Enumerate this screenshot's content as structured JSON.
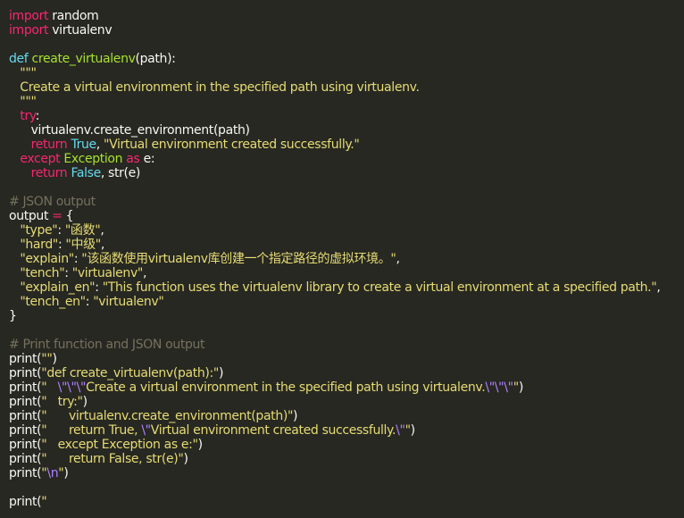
{
  "theme": {
    "background": "#272822",
    "foreground": "#f8f8f2",
    "keyword": "#f92672",
    "function_name": "#a6e22e",
    "builtin": "#66d9ef",
    "string": "#e6db74",
    "comment": "#75715e",
    "escape": "#ae81ff"
  },
  "code_lines": [
    [
      {
        "t": "kw",
        "v": "import"
      },
      {
        "t": "pl",
        "v": " random"
      }
    ],
    [
      {
        "t": "kw",
        "v": "import"
      },
      {
        "t": "pl",
        "v": " virtualenv"
      }
    ],
    [],
    [
      {
        "t": "bi",
        "v": "def"
      },
      {
        "t": "pl",
        "v": " "
      },
      {
        "t": "fn",
        "v": "create_virtualenv"
      },
      {
        "t": "pl",
        "v": "(path):"
      }
    ],
    [
      {
        "t": "str",
        "v": "   \"\"\""
      }
    ],
    [
      {
        "t": "str",
        "v": "   Create a virtual environment in the specified path using virtualenv."
      }
    ],
    [
      {
        "t": "str",
        "v": "   \"\"\""
      }
    ],
    [
      {
        "t": "pl",
        "v": "   "
      },
      {
        "t": "kw",
        "v": "try"
      },
      {
        "t": "pl",
        "v": ":"
      }
    ],
    [
      {
        "t": "pl",
        "v": "      virtualenv.create_environment(path)"
      }
    ],
    [
      {
        "t": "pl",
        "v": "      "
      },
      {
        "t": "kw",
        "v": "return"
      },
      {
        "t": "pl",
        "v": " "
      },
      {
        "t": "bi",
        "v": "True"
      },
      {
        "t": "pl",
        "v": ", "
      },
      {
        "t": "str",
        "v": "\"Virtual environment created successfully.\""
      }
    ],
    [
      {
        "t": "pl",
        "v": "   "
      },
      {
        "t": "kw",
        "v": "except"
      },
      {
        "t": "pl",
        "v": " "
      },
      {
        "t": "fn",
        "v": "Exception"
      },
      {
        "t": "pl",
        "v": " "
      },
      {
        "t": "kw",
        "v": "as"
      },
      {
        "t": "pl",
        "v": " e:"
      }
    ],
    [
      {
        "t": "pl",
        "v": "      "
      },
      {
        "t": "kw",
        "v": "return"
      },
      {
        "t": "pl",
        "v": " "
      },
      {
        "t": "bi",
        "v": "False"
      },
      {
        "t": "pl",
        "v": ", str(e)"
      }
    ],
    [],
    [
      {
        "t": "cm",
        "v": "# JSON output"
      }
    ],
    [
      {
        "t": "pl",
        "v": "output "
      },
      {
        "t": "kw",
        "v": "="
      },
      {
        "t": "pl",
        "v": " {"
      }
    ],
    [
      {
        "t": "pl",
        "v": "   "
      },
      {
        "t": "str",
        "v": "\"type\""
      },
      {
        "t": "pl",
        "v": ": "
      },
      {
        "t": "str",
        "v": "\"函数\""
      },
      {
        "t": "pl",
        "v": ","
      }
    ],
    [
      {
        "t": "pl",
        "v": "   "
      },
      {
        "t": "str",
        "v": "\"hard\""
      },
      {
        "t": "pl",
        "v": ": "
      },
      {
        "t": "str",
        "v": "\"中级\""
      },
      {
        "t": "pl",
        "v": ","
      }
    ],
    [
      {
        "t": "pl",
        "v": "   "
      },
      {
        "t": "str",
        "v": "\"explain\""
      },
      {
        "t": "pl",
        "v": ": "
      },
      {
        "t": "str",
        "v": "\"该函数使用virtualenv库创建一个指定路径的虚拟环境。\""
      },
      {
        "t": "pl",
        "v": ","
      }
    ],
    [
      {
        "t": "pl",
        "v": "   "
      },
      {
        "t": "str",
        "v": "\"tench\""
      },
      {
        "t": "pl",
        "v": ": "
      },
      {
        "t": "str",
        "v": "\"virtualenv\""
      },
      {
        "t": "pl",
        "v": ","
      }
    ],
    [
      {
        "t": "pl",
        "v": "   "
      },
      {
        "t": "str",
        "v": "\"explain_en\""
      },
      {
        "t": "pl",
        "v": ": "
      },
      {
        "t": "str",
        "v": "\"This function uses the virtualenv library to create a virtual environment at a specified path.\""
      },
      {
        "t": "pl",
        "v": ","
      }
    ],
    [
      {
        "t": "pl",
        "v": "   "
      },
      {
        "t": "str",
        "v": "\"tench_en\""
      },
      {
        "t": "pl",
        "v": ": "
      },
      {
        "t": "str",
        "v": "\"virtualenv\""
      }
    ],
    [
      {
        "t": "pl",
        "v": "}"
      }
    ],
    [],
    [
      {
        "t": "cm",
        "v": "# Print function and JSON output"
      }
    ],
    [
      {
        "t": "pl",
        "v": "print("
      },
      {
        "t": "str",
        "v": "\"\""
      },
      {
        "t": "pl",
        "v": ")"
      }
    ],
    [
      {
        "t": "pl",
        "v": "print("
      },
      {
        "t": "str",
        "v": "\"def create_virtualenv(path):\""
      },
      {
        "t": "pl",
        "v": ")"
      }
    ],
    [
      {
        "t": "pl",
        "v": "print("
      },
      {
        "t": "str",
        "v": "\"   "
      },
      {
        "t": "esc",
        "v": "\\\""
      },
      {
        "t": "esc",
        "v": "\\\""
      },
      {
        "t": "esc",
        "v": "\\\""
      },
      {
        "t": "str",
        "v": "Create a virtual environment in the specified path using virtualenv."
      },
      {
        "t": "esc",
        "v": "\\\""
      },
      {
        "t": "esc",
        "v": "\\\""
      },
      {
        "t": "esc",
        "v": "\\\""
      },
      {
        "t": "str",
        "v": "\""
      },
      {
        "t": "pl",
        "v": ")"
      }
    ],
    [
      {
        "t": "pl",
        "v": "print("
      },
      {
        "t": "str",
        "v": "\"   try:\""
      },
      {
        "t": "pl",
        "v": ")"
      }
    ],
    [
      {
        "t": "pl",
        "v": "print("
      },
      {
        "t": "str",
        "v": "\"      virtualenv.create_environment(path)\""
      },
      {
        "t": "pl",
        "v": ")"
      }
    ],
    [
      {
        "t": "pl",
        "v": "print("
      },
      {
        "t": "str",
        "v": "\"      return True, "
      },
      {
        "t": "esc",
        "v": "\\\""
      },
      {
        "t": "str",
        "v": "Virtual environment created successfully."
      },
      {
        "t": "esc",
        "v": "\\\""
      },
      {
        "t": "str",
        "v": "\""
      },
      {
        "t": "pl",
        "v": ")"
      }
    ],
    [
      {
        "t": "pl",
        "v": "print("
      },
      {
        "t": "str",
        "v": "\"   except Exception as e:\""
      },
      {
        "t": "pl",
        "v": ")"
      }
    ],
    [
      {
        "t": "pl",
        "v": "print("
      },
      {
        "t": "str",
        "v": "\"      return False, str(e)\""
      },
      {
        "t": "pl",
        "v": ")"
      }
    ],
    [
      {
        "t": "pl",
        "v": "print("
      },
      {
        "t": "str",
        "v": "\""
      },
      {
        "t": "esc",
        "v": "\\n"
      },
      {
        "t": "str",
        "v": "\""
      },
      {
        "t": "pl",
        "v": ")"
      }
    ],
    [],
    [
      {
        "t": "pl",
        "v": "print("
      },
      {
        "t": "str",
        "v": "\""
      }
    ]
  ]
}
